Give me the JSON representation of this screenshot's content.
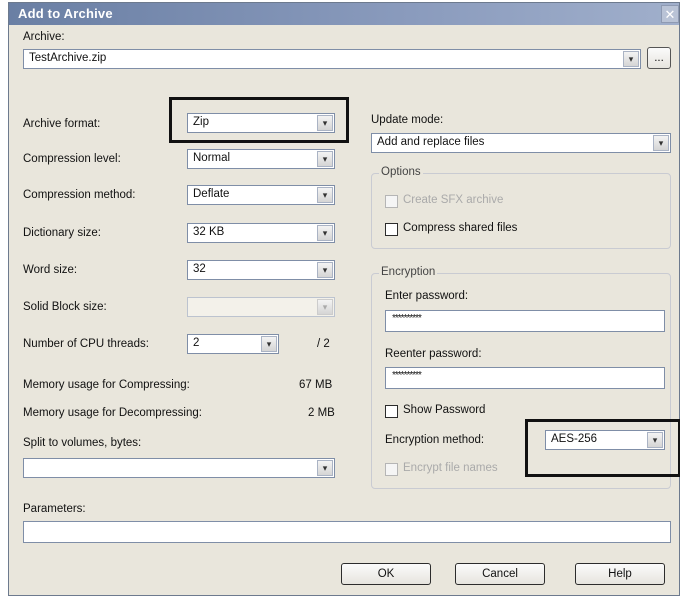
{
  "window": {
    "title": "Add to Archive",
    "close_glyph": "✕"
  },
  "archive": {
    "label": "Archive:",
    "value": "TestArchive.zip",
    "browse_label": "..."
  },
  "left": {
    "format_label": "Archive format:",
    "format_value": "Zip",
    "compression_level_label": "Compression level:",
    "compression_level_value": "Normal",
    "compression_method_label": "Compression method:",
    "compression_method_value": "Deflate",
    "dictionary_size_label": "Dictionary size:",
    "dictionary_size_value": "32 KB",
    "word_size_label": "Word size:",
    "word_size_value": "32",
    "solid_block_label": "Solid Block size:",
    "solid_block_value": "",
    "cpu_threads_label": "Number of CPU threads:",
    "cpu_threads_value": "2",
    "cpu_threads_max": "/ 2",
    "mem_comp_label": "Memory usage for Compressing:",
    "mem_comp_value": "67 MB",
    "mem_decomp_label": "Memory usage for Decompressing:",
    "mem_decomp_value": "2 MB",
    "split_label": "Split to volumes, bytes:",
    "split_value": ""
  },
  "right": {
    "update_mode_label": "Update mode:",
    "update_mode_value": "Add and replace files",
    "options": {
      "title": "Options",
      "sfx_label": "Create SFX archive",
      "shared_label": "Compress shared files"
    },
    "encryption": {
      "title": "Encryption",
      "enter_password_label": "Enter password:",
      "enter_password_value": "**********",
      "reenter_password_label": "Reenter password:",
      "reenter_password_value": "**********",
      "show_password_label": "Show Password",
      "method_label": "Encryption method:",
      "method_value": "AES-256",
      "encrypt_names_label": "Encrypt file names"
    }
  },
  "parameters": {
    "label": "Parameters:",
    "value": ""
  },
  "buttons": {
    "ok": "OK",
    "cancel": "Cancel",
    "help": "Help"
  },
  "icons": {
    "dropdown": "▾"
  }
}
